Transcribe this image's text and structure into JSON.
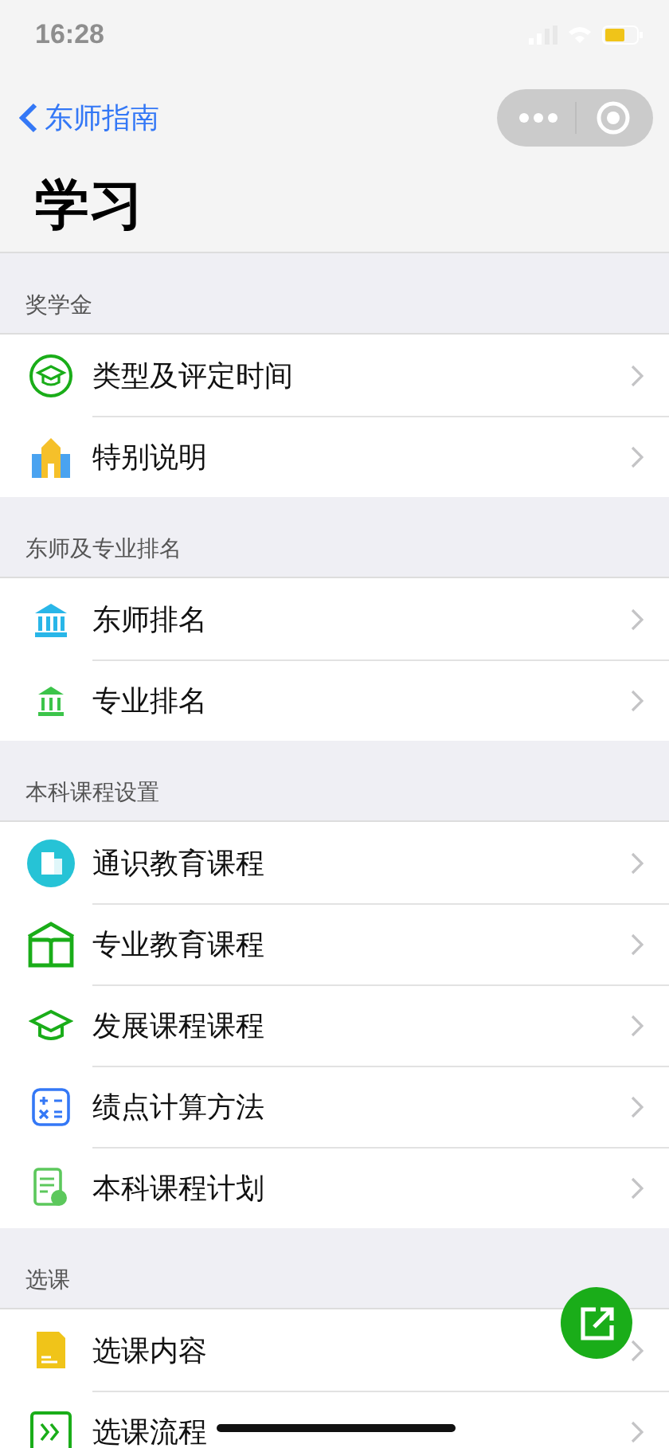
{
  "status_bar": {
    "time": "16:28"
  },
  "nav": {
    "back": "东师指南"
  },
  "title": "学习",
  "sections": [
    {
      "header": "奖学金",
      "items": [
        "类型及评定时间",
        "特别说明"
      ]
    },
    {
      "header": "东师及专业排名",
      "items": [
        "东师排名",
        "专业排名"
      ]
    },
    {
      "header": "本科课程设置",
      "items": [
        "通识教育课程",
        "专业教育课程",
        "发展课程课程",
        "绩点计算方法",
        "本科课程计划"
      ]
    },
    {
      "header": "选课",
      "items": [
        "选课内容",
        "选课流程"
      ]
    }
  ]
}
